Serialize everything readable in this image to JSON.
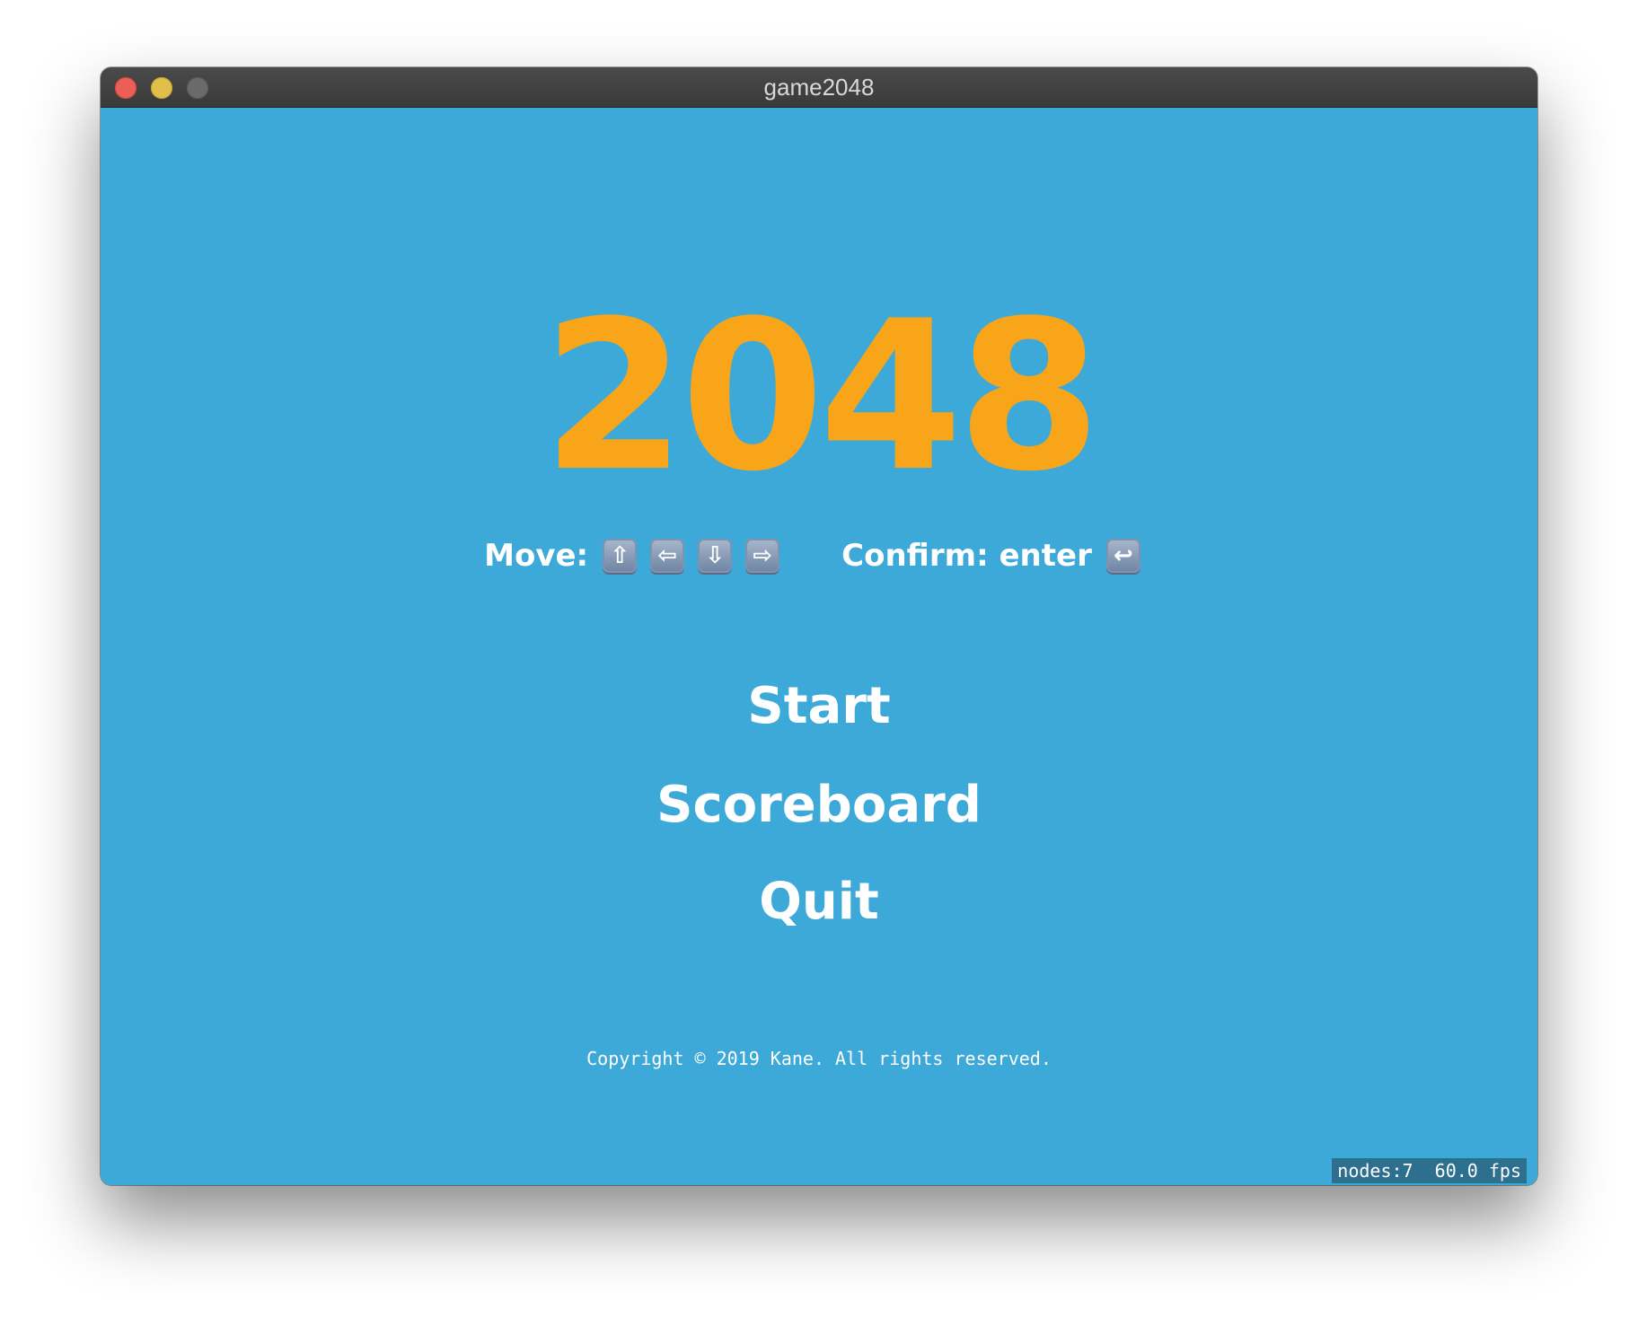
{
  "window": {
    "title": "game2048"
  },
  "game": {
    "logo": "2048",
    "logo_color": "#f9a51a",
    "background_color": "#3da9d8",
    "controls": {
      "move_label": "Move:",
      "move_keys": [
        "⇧",
        "⇦",
        "⇩",
        "⇨"
      ],
      "confirm_label": "Confirm: enter",
      "confirm_key": "↩"
    },
    "menu": {
      "start": "Start",
      "scoreboard": "Scoreboard",
      "quit": "Quit"
    },
    "copyright": "Copyright © 2019 Kane. All rights reserved.",
    "stats": "nodes:7  60.0 fps"
  }
}
